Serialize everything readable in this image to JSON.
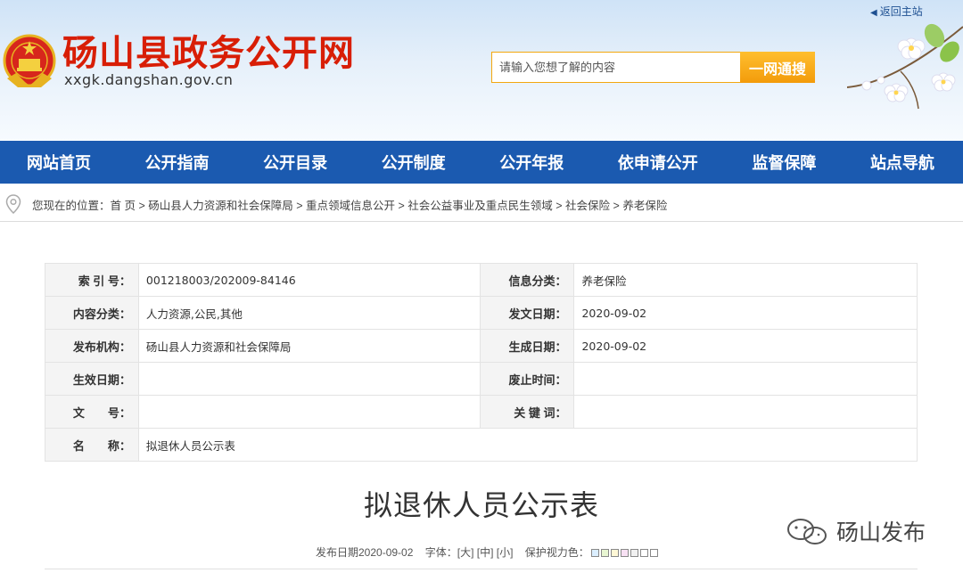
{
  "header": {
    "site_title": "砀山县政务公开网",
    "site_domain": "xxgk.dangshan.gov.cn",
    "return_home": "返回主站",
    "search_placeholder": "请输入您想了解的内容",
    "search_button": "一网通搜"
  },
  "nav": {
    "items": [
      "网站首页",
      "公开指南",
      "公开目录",
      "公开制度",
      "公开年报",
      "依申请公开",
      "监督保障",
      "站点导航"
    ]
  },
  "breadcrumb": {
    "prefix": "您现在的位置：",
    "items": [
      "首 页",
      "砀山县人力资源和社会保障局",
      "重点领域信息公开",
      "社会公益事业及重点民生领域",
      "社会保险",
      "养老保险"
    ],
    "separator": " > "
  },
  "info_table": {
    "index_label": "索 引 号：",
    "index_value": "001218003/202009-84146",
    "category_label": "信息分类：",
    "category_value": "养老保险",
    "content_label": "内容分类：",
    "content_value": "人力资源,公民,其他",
    "issue_date_label": "发文日期：",
    "issue_date_value": "2020-09-02",
    "publisher_label": "发布机构：",
    "publisher_value": "砀山县人力资源和社会保障局",
    "generated_label": "生成日期：",
    "generated_value": "2020-09-02",
    "effective_label": "生效日期：",
    "effective_value": "",
    "abolish_label": "废止时间：",
    "abolish_value": "",
    "doc_no_label": "文　　号：",
    "doc_no_value": "",
    "keywords_label": "关 键 词：",
    "keywords_value": "",
    "name_label": "名　　称：",
    "name_value": "拟退休人员公示表"
  },
  "document": {
    "title": "拟退休人员公示表",
    "publish_prefix": "发布日期2020-09-02",
    "font_label": "字体：",
    "font_large": "[大]",
    "font_medium": "[中]",
    "font_small": "[小]",
    "eye_care_label": "保护视力色：",
    "eye_colors": [
      "#dbeeff",
      "#e8f6d2",
      "#fff8d6",
      "#f8e1f4",
      "#f1f1f1",
      "#ffffff",
      "#ffffff"
    ]
  },
  "watermark": {
    "text": "砀山发布"
  },
  "colors": {
    "nav_bg": "#1b5ab0",
    "title_red": "#d81e06",
    "search_btn": "#f39b0a"
  }
}
